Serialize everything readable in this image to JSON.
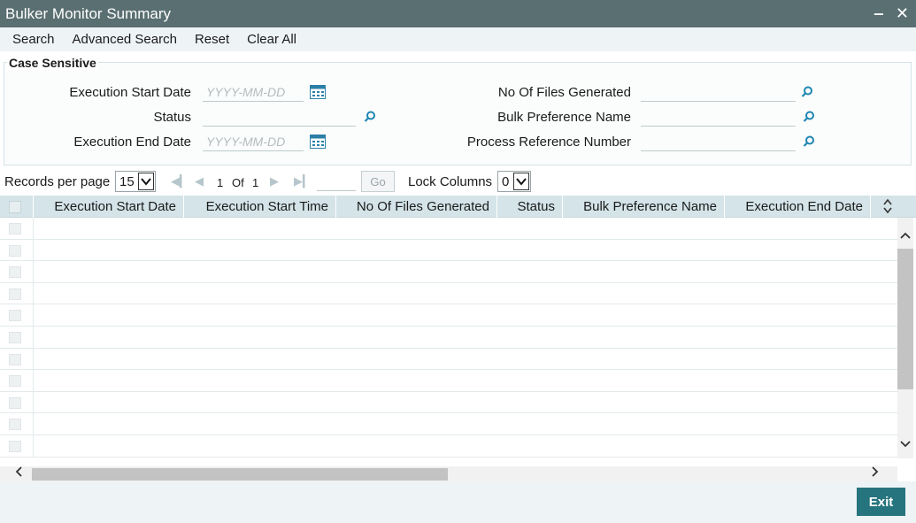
{
  "window": {
    "title": "Bulker Monitor Summary",
    "minimize": "‒",
    "close": "✕"
  },
  "menu": [
    "Search",
    "Advanced Search",
    "Reset",
    "Clear All"
  ],
  "criteria": {
    "legend": "Case Sensitive",
    "left": [
      {
        "label": "Execution Start Date",
        "placeholder": "YYYY-MM-DD",
        "icon": "calendar-icon"
      },
      {
        "label": "Status",
        "placeholder": "",
        "icon": "search-icon"
      },
      {
        "label": "Execution End Date",
        "placeholder": "YYYY-MM-DD",
        "icon": "calendar-icon"
      }
    ],
    "right": [
      {
        "label": "No Of Files Generated",
        "placeholder": "",
        "icon": "search-icon"
      },
      {
        "label": "Bulk Preference Name",
        "placeholder": "",
        "icon": "search-icon"
      },
      {
        "label": "Process Reference Number",
        "placeholder": "",
        "icon": "search-icon"
      }
    ]
  },
  "pager": {
    "records_label": "Records per page",
    "records_value": "15",
    "page": "1",
    "of_label": "Of",
    "total_pages": "1",
    "go_label": "Go",
    "lock_label": "Lock Columns",
    "lock_value": "0"
  },
  "grid": {
    "columns": [
      "Execution Start Date",
      "Execution Start Time",
      "No Of Files Generated",
      "Status",
      "Bulk Preference Name",
      "Execution End Date"
    ],
    "row_count": 11
  },
  "footer": {
    "exit_label": "Exit"
  },
  "colors": {
    "titlebar": "#5a6f71",
    "accent": "#26747e",
    "header": "#d4e4e9"
  }
}
